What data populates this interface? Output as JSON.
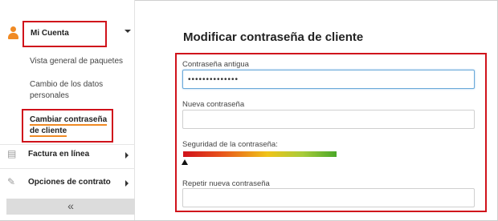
{
  "sidebar": {
    "account": {
      "label": "Mi Cuenta",
      "icon": "person-icon"
    },
    "sub_items": [
      {
        "label": "Vista general de paquetes"
      },
      {
        "label": "Cambio de los datos personales"
      },
      {
        "label": "Cambiar contraseña de cliente"
      }
    ],
    "invoice": {
      "label": "Factura en línea",
      "icon": "document-icon"
    },
    "contract": {
      "label": "Opciones de contrato",
      "icon": "edit-icon"
    },
    "collapse": "«"
  },
  "main": {
    "title": "Modificar contraseña de cliente",
    "old_password": {
      "label": "Contraseña antigua",
      "value": "••••••••••••••"
    },
    "new_password": {
      "label": "Nueva contraseña",
      "value": ""
    },
    "strength": {
      "label": "Seguridad de la contraseña:",
      "level": 0.0
    },
    "repeat_password": {
      "label": "Repetir nueva contraseña",
      "value": ""
    }
  },
  "colors": {
    "accent": "#f08a24",
    "highlight_box": "#d0121b"
  }
}
